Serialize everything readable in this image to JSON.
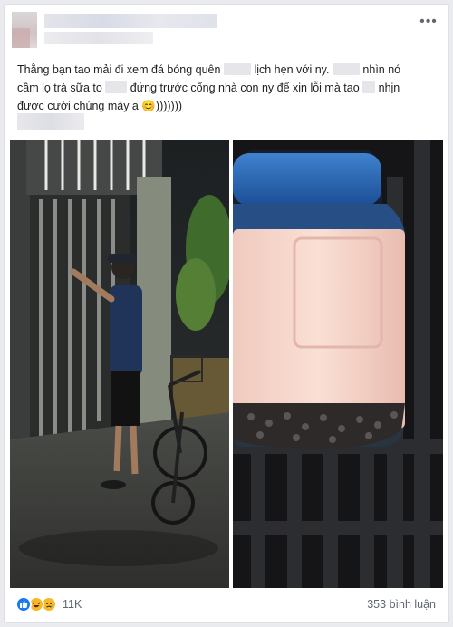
{
  "post": {
    "line1_a": "Thằng bạn tao mải đi xem đá bóng quên",
    "line1_b": "lịch hẹn với ny.",
    "line1_c": "nhìn nó",
    "line2_a": "cầm lọ trà sữa to",
    "line2_b": "đứng trước cổng nhà con ny để xin lỗi mà tao",
    "line2_c": "nhịn",
    "line3": "được cười chúng mày ạ 😊)))))))"
  },
  "footer": {
    "reaction_count": "11K",
    "comment_count": "353 bình luận"
  },
  "icons": {
    "more": "more-horizontal-icon",
    "like": "like-icon",
    "haha": "haha-icon",
    "sad": "sad-icon"
  },
  "colors": {
    "brand_blue": "#1877f2",
    "reaction_yellow": "#f7b928",
    "text_primary": "#1c1e21",
    "text_secondary": "#606770"
  }
}
